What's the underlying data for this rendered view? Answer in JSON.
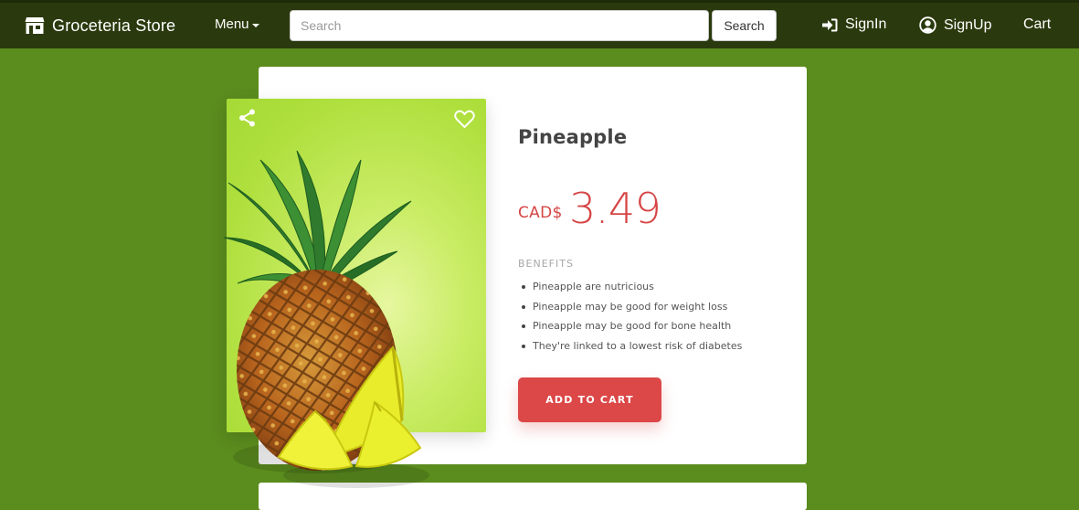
{
  "header": {
    "brand": "Groceteria Store",
    "menu_label": "Menu",
    "search_placeholder": "Search",
    "search_button": "Search",
    "signin_label": "SignIn",
    "signup_label": "SignUp",
    "cart_label": "Cart"
  },
  "product": {
    "name": "Pineapple",
    "currency": "CAD$",
    "price": "3.49",
    "benefits_heading": "BENEFITS",
    "benefits": [
      "Pineapple are nutricious",
      "Pineapple may be good for weight loss",
      "Pineapple may be good for bone health",
      "They're linked to a lowest risk of diabetes"
    ],
    "add_to_cart": "ADD TO CART",
    "image_icon": "pineapple-image"
  },
  "colors": {
    "header_bg": "#2b3a0e",
    "page_bg": "#5b8c1e",
    "accent_red": "#dc4747",
    "image_bg": "#b5e245"
  }
}
